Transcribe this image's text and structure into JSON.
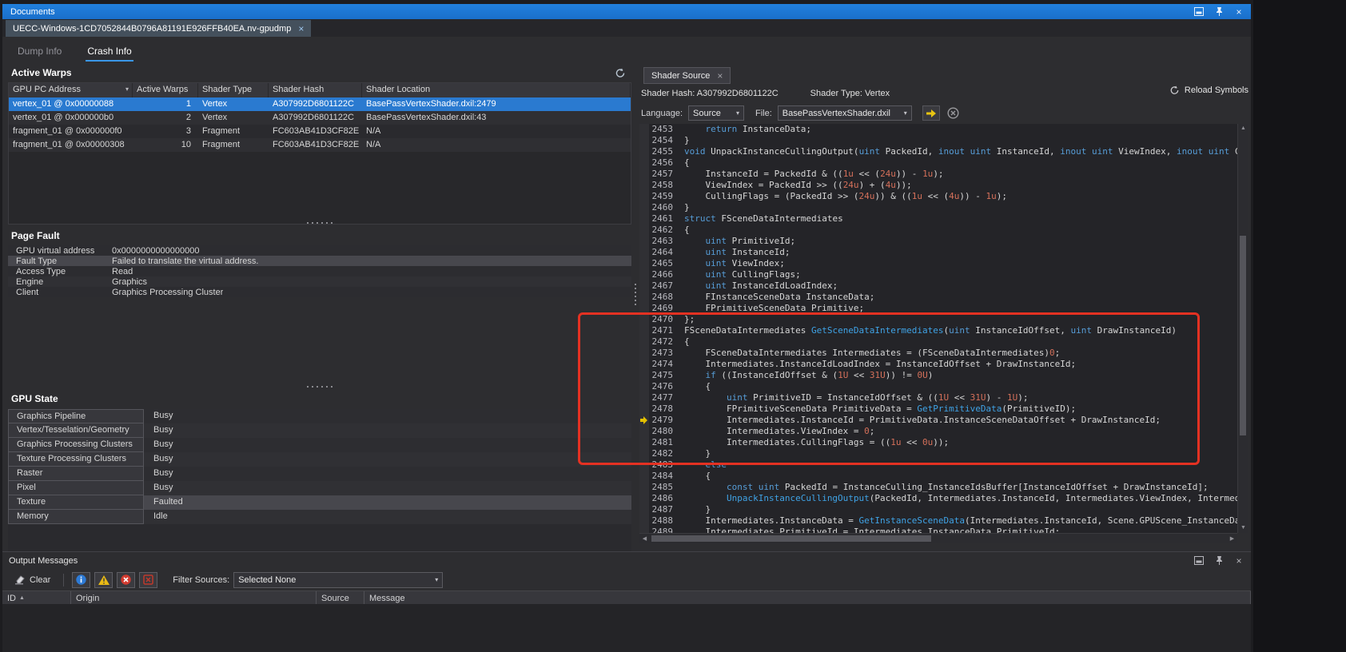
{
  "window": {
    "title": "Documents"
  },
  "icons": {
    "close": "×",
    "dropdown": "▾",
    "filter": "▾",
    "sort_asc": "▲",
    "up": "▲",
    "down": "▼",
    "left": "◀",
    "right": "▶"
  },
  "document_tab": {
    "label": "UECC-Windows-1CD7052844B0796A81191E926FFB40EA.nv-gpudmp"
  },
  "view_tabs": [
    {
      "label": "Dump Info",
      "active": false
    },
    {
      "label": "Crash Info",
      "active": true
    }
  ],
  "active_warps": {
    "title": "Active Warps",
    "columns": [
      "GPU PC Address",
      "Active Warps",
      "Shader Type",
      "Shader Hash",
      "Shader Location"
    ],
    "rows": [
      {
        "pc": "vertex_01 @ 0x00000088",
        "warps": "1",
        "type": "Vertex",
        "hash": "A307992D6801122C",
        "location": "BasePassVertexShader.dxil:2479",
        "selected": true
      },
      {
        "pc": "vertex_01 @ 0x000000b0",
        "warps": "2",
        "type": "Vertex",
        "hash": "A307992D6801122C",
        "location": "BasePassVertexShader.dxil:43",
        "selected": false
      },
      {
        "pc": "fragment_01 @ 0x000000f0",
        "warps": "3",
        "type": "Fragment",
        "hash": "FC603AB41D3CF82E",
        "location": "N/A",
        "selected": false
      },
      {
        "pc": "fragment_01 @ 0x00000308",
        "warps": "10",
        "type": "Fragment",
        "hash": "FC603AB41D3CF82E",
        "location": "N/A",
        "selected": false
      }
    ]
  },
  "page_fault": {
    "title": "Page Fault",
    "highlight_index": 1,
    "rows": [
      [
        "GPU virtual address",
        "0x0000000000000000"
      ],
      [
        "Fault Type",
        "Failed to translate the virtual address."
      ],
      [
        "Access Type",
        "Read"
      ],
      [
        "Engine",
        "Graphics"
      ],
      [
        "Client",
        "Graphics Processing Cluster"
      ]
    ]
  },
  "gpu_state": {
    "title": "GPU State",
    "highlight_index": 6,
    "rows": [
      [
        "Graphics Pipeline",
        "Busy"
      ],
      [
        "Vertex/Tesselation/Geometry",
        "Busy"
      ],
      [
        "Graphics Processing Clusters",
        "Busy"
      ],
      [
        "Texture Processing Clusters",
        "Busy"
      ],
      [
        "Raster",
        "Busy"
      ],
      [
        "Pixel",
        "Busy"
      ],
      [
        "Texture",
        "Faulted"
      ],
      [
        "Memory",
        "Idle"
      ]
    ]
  },
  "shader_panel": {
    "tab_label": "Shader Source",
    "hash_label": "Shader Hash: A307992D6801122C",
    "type_label": "Shader Type: Vertex",
    "reload_label": "Reload Symbols",
    "language_label": "Language:",
    "language_value": "Source",
    "file_label": "File:",
    "file_value": "BasePassVertexShader.dxil",
    "code": {
      "first_line": 2453,
      "current_line": 2479,
      "lines": [
        [
          [
            "p",
            "    "
          ],
          [
            "k",
            "return"
          ],
          [
            "p",
            " InstanceData;"
          ]
        ],
        [
          [
            "p",
            "}"
          ]
        ],
        [
          [
            "k",
            "void"
          ],
          [
            "p",
            " UnpackInstanceCullingOutput("
          ],
          [
            "k",
            "uint"
          ],
          [
            "p",
            " PackedId, "
          ],
          [
            "k",
            "inout"
          ],
          [
            "p",
            " "
          ],
          [
            "k",
            "uint"
          ],
          [
            "p",
            " InstanceId, "
          ],
          [
            "k",
            "inout"
          ],
          [
            "p",
            " "
          ],
          [
            "k",
            "uint"
          ],
          [
            "p",
            " ViewIndex, "
          ],
          [
            "k",
            "inout"
          ],
          [
            "p",
            " "
          ],
          [
            "k",
            "uint"
          ],
          [
            "p",
            " Cull"
          ]
        ],
        [
          [
            "p",
            "{"
          ]
        ],
        [
          [
            "p",
            "    InstanceId = PackedId & (("
          ],
          [
            "n",
            "1u"
          ],
          [
            "p",
            " << ("
          ],
          [
            "n",
            "24u"
          ],
          [
            "p",
            ")) - "
          ],
          [
            "n",
            "1u"
          ],
          [
            "p",
            ");"
          ]
        ],
        [
          [
            "p",
            "    ViewIndex = PackedId >> (("
          ],
          [
            "n",
            "24u"
          ],
          [
            "p",
            ") + ("
          ],
          [
            "n",
            "4u"
          ],
          [
            "p",
            "));"
          ]
        ],
        [
          [
            "p",
            "    CullingFlags = (PackedId >> ("
          ],
          [
            "n",
            "24u"
          ],
          [
            "p",
            ")) & (("
          ],
          [
            "n",
            "1u"
          ],
          [
            "p",
            " << ("
          ],
          [
            "n",
            "4u"
          ],
          [
            "p",
            ")) - "
          ],
          [
            "n",
            "1u"
          ],
          [
            "p",
            ");"
          ]
        ],
        [
          [
            "p",
            "}"
          ]
        ],
        [
          [
            "k",
            "struct"
          ],
          [
            "p",
            " FSceneDataIntermediates"
          ]
        ],
        [
          [
            "p",
            "{"
          ]
        ],
        [
          [
            "p",
            "    "
          ],
          [
            "k",
            "uint"
          ],
          [
            "p",
            " PrimitiveId;"
          ]
        ],
        [
          [
            "p",
            "    "
          ],
          [
            "k",
            "uint"
          ],
          [
            "p",
            " InstanceId;"
          ]
        ],
        [
          [
            "p",
            "    "
          ],
          [
            "k",
            "uint"
          ],
          [
            "p",
            " ViewIndex;"
          ]
        ],
        [
          [
            "p",
            "    "
          ],
          [
            "k",
            "uint"
          ],
          [
            "p",
            " CullingFlags;"
          ]
        ],
        [
          [
            "p",
            "    "
          ],
          [
            "k",
            "uint"
          ],
          [
            "p",
            " InstanceIdLoadIndex;"
          ]
        ],
        [
          [
            "p",
            "    FInstanceSceneData InstanceData;"
          ]
        ],
        [
          [
            "p",
            "    FPrimitiveSceneData Primitive;"
          ]
        ],
        [
          [
            "p",
            "};"
          ]
        ],
        [
          [
            "p",
            "FSceneDataIntermediates "
          ],
          [
            "f",
            "GetSceneDataIntermediates"
          ],
          [
            "p",
            "("
          ],
          [
            "k",
            "uint"
          ],
          [
            "p",
            " InstanceIdOffset, "
          ],
          [
            "k",
            "uint"
          ],
          [
            "p",
            " DrawInstanceId)"
          ]
        ],
        [
          [
            "p",
            "{"
          ]
        ],
        [
          [
            "p",
            "    FSceneDataIntermediates Intermediates = (FSceneDataIntermediates)"
          ],
          [
            "n",
            "0"
          ],
          [
            "p",
            ";"
          ]
        ],
        [
          [
            "p",
            "    Intermediates.InstanceIdLoadIndex = InstanceIdOffset + DrawInstanceId;"
          ]
        ],
        [
          [
            "p",
            "    "
          ],
          [
            "k",
            "if"
          ],
          [
            "p",
            " ((InstanceIdOffset & ("
          ],
          [
            "n",
            "1U"
          ],
          [
            "p",
            " << "
          ],
          [
            "n",
            "31U"
          ],
          [
            "p",
            ")) != "
          ],
          [
            "n",
            "0U"
          ],
          [
            "p",
            ")"
          ]
        ],
        [
          [
            "p",
            "    {"
          ]
        ],
        [
          [
            "p",
            "        "
          ],
          [
            "k",
            "uint"
          ],
          [
            "p",
            " PrimitiveID = InstanceIdOffset & (("
          ],
          [
            "n",
            "1U"
          ],
          [
            "p",
            " << "
          ],
          [
            "n",
            "31U"
          ],
          [
            "p",
            ") - "
          ],
          [
            "n",
            "1U"
          ],
          [
            "p",
            ");"
          ]
        ],
        [
          [
            "p",
            "        FPrimitiveSceneData PrimitiveData = "
          ],
          [
            "f",
            "GetPrimitiveData"
          ],
          [
            "p",
            "(PrimitiveID);"
          ]
        ],
        [
          [
            "p",
            "        Intermediates.InstanceId = PrimitiveData.InstanceSceneDataOffset + DrawInstanceId;"
          ]
        ],
        [
          [
            "p",
            "        Intermediates.ViewIndex = "
          ],
          [
            "n",
            "0"
          ],
          [
            "p",
            ";"
          ]
        ],
        [
          [
            "p",
            "        Intermediates.CullingFlags = (("
          ],
          [
            "n",
            "1u"
          ],
          [
            "p",
            " << "
          ],
          [
            "n",
            "0u"
          ],
          [
            "p",
            "));"
          ]
        ],
        [
          [
            "p",
            "    }"
          ]
        ],
        [
          [
            "p",
            "    "
          ],
          [
            "k",
            "else"
          ]
        ],
        [
          [
            "p",
            "    {"
          ]
        ],
        [
          [
            "p",
            "        "
          ],
          [
            "k",
            "const"
          ],
          [
            "p",
            " "
          ],
          [
            "k",
            "uint"
          ],
          [
            "p",
            " PackedId = InstanceCulling_InstanceIdsBuffer[InstanceIdOffset + DrawInstanceId];"
          ]
        ],
        [
          [
            "p",
            "        "
          ],
          [
            "f",
            "UnpackInstanceCullingOutput"
          ],
          [
            "p",
            "(PackedId, Intermediates.InstanceId, Intermediates.ViewIndex, Intermediat"
          ]
        ],
        [
          [
            "p",
            "    }"
          ]
        ],
        [
          [
            "p",
            "    Intermediates.InstanceData = "
          ],
          [
            "f",
            "GetInstanceSceneData"
          ],
          [
            "p",
            "(Intermediates.InstanceId, Scene.GPUScene_InstanceData"
          ]
        ],
        [
          [
            "p",
            "    Intermediates.PrimitiveId = Intermediates.InstanceData.PrimitiveId;"
          ]
        ]
      ]
    }
  },
  "output_messages": {
    "title": "Output Messages",
    "clear_label": "Clear",
    "filter_label": "Filter Sources:",
    "filter_value": "Selected None",
    "columns": [
      "ID",
      "Origin",
      "Source",
      "Message"
    ]
  },
  "colors": {
    "titlebar": "#1b74d1",
    "selection": "#2a7ad0",
    "annotation": "#e43122",
    "keyword": "#569cd6",
    "number": "#d4705a",
    "function_call": "#3fa3e6",
    "warning": "#e9ba15",
    "error": "#d23b30",
    "current_line_arrow": "#e3c000"
  }
}
